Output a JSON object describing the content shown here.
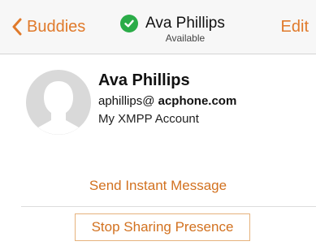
{
  "nav": {
    "back_label": "Buddies",
    "title": "Ava Phillips",
    "subtitle": "Available",
    "edit_label": "Edit"
  },
  "contact": {
    "name": "Ava Phillips",
    "email_user": "aphillips@",
    "email_domain": "acphone.com",
    "account": "My XMPP Account"
  },
  "actions": {
    "send_message": "Send Instant Message",
    "stop_sharing": "Stop Sharing Presence"
  },
  "colors": {
    "accent": "#e07a2b",
    "status_available": "#2bac48"
  },
  "icons": {
    "back": "chevron-left-icon",
    "status": "check-circle-icon",
    "avatar": "default-avatar-icon"
  }
}
